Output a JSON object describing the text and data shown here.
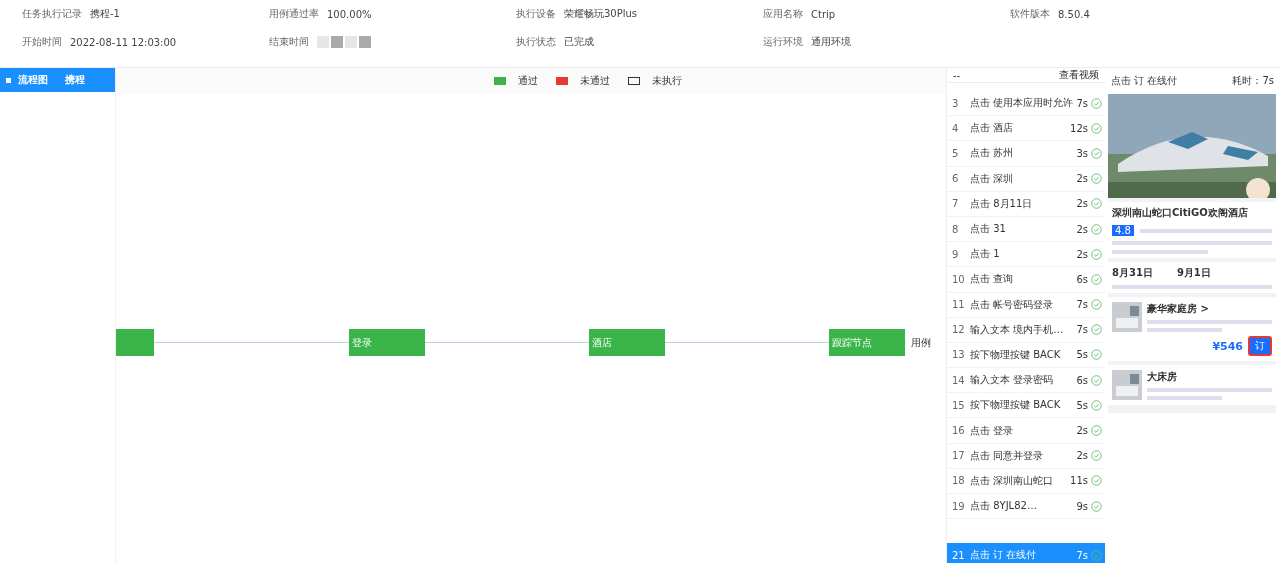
{
  "info_rows": [
    [
      {
        "label": "任务执行记录",
        "value": "携程-1"
      },
      {
        "label": "用例通过率",
        "value": "100.00%"
      },
      {
        "label": "执行设备",
        "value": "荣耀畅玩30Plus"
      },
      {
        "label": "应用名称",
        "value": "Ctrip"
      },
      {
        "label": "软件版本",
        "value": "8.50.4"
      }
    ],
    [
      {
        "label": "开始时间",
        "value": "2022-08-11 12:03:00"
      },
      {
        "label": "结束时间",
        "redacted": true
      },
      {
        "label": "执行状态",
        "value": "已完成"
      },
      {
        "label": "运行环境",
        "value": "通用环境"
      }
    ]
  ],
  "sidebar": {
    "items": [
      {
        "label": "流程图",
        "value": "携程",
        "selected": true
      }
    ]
  },
  "legend": [
    {
      "label": "通过",
      "kind": "filled",
      "color": "#3bb54a"
    },
    {
      "label": "未通过",
      "kind": "filled",
      "color": "#e53935"
    },
    {
      "label": "未执行",
      "kind": "outline",
      "color": "#333333"
    }
  ],
  "flow": {
    "nodes": [
      {
        "passed": true,
        "cut": true
      },
      {
        "label": "登录",
        "passed": true
      },
      {
        "label": "酒店",
        "passed": true
      },
      {
        "label": "跟踪节点",
        "passed": true
      }
    ],
    "trailing_label": "用例"
  },
  "steps_header": {
    "left": "--",
    "right": "查看视频"
  },
  "steps": [
    {
      "index": "3",
      "action": "点击 使用本应用时允许",
      "time": "7s",
      "passed": true,
      "selected": false
    },
    {
      "index": "4",
      "action": "点击 酒店",
      "time": "12s",
      "passed": true,
      "selected": false
    },
    {
      "index": "5",
      "action": "点击 苏州",
      "time": "3s",
      "passed": true,
      "selected": false
    },
    {
      "index": "6",
      "action": "点击 深圳",
      "time": "2s",
      "passed": true,
      "selected": false
    },
    {
      "index": "7",
      "action": "点击 8月11日",
      "time": "2s",
      "passed": true,
      "selected": false
    },
    {
      "index": "8",
      "action": "点击 31",
      "time": "2s",
      "passed": true,
      "selected": false
    },
    {
      "index": "9",
      "action": "点击 1",
      "time": "2s",
      "passed": true,
      "selected": false
    },
    {
      "index": "10",
      "action": "点击 查询",
      "time": "6s",
      "passed": true,
      "selected": false
    },
    {
      "index": "11",
      "action": "点击 帐号密码登录",
      "time": "7s",
      "passed": true,
      "selected": false
    },
    {
      "index": "12",
      "action": "输入文本 境内手机…",
      "time": "7s",
      "passed": true,
      "selected": false
    },
    {
      "index": "13",
      "action": "按下物理按键 BACK",
      "time": "5s",
      "passed": true,
      "selected": false
    },
    {
      "index": "14",
      "action": "输入文本 登录密码",
      "time": "6s",
      "passed": true,
      "selected": false
    },
    {
      "index": "15",
      "action": "按下物理按键 BACK",
      "time": "5s",
      "passed": true,
      "selected": false
    },
    {
      "index": "16",
      "action": "点击 登录",
      "time": "2s",
      "passed": true,
      "selected": false
    },
    {
      "index": "17",
      "action": "点击 同意并登录",
      "time": "2s",
      "passed": true,
      "selected": false
    },
    {
      "index": "18",
      "action": "点击 深圳南山蛇口",
      "time": "11s",
      "passed": true,
      "selected": false
    },
    {
      "index": "19",
      "action": "点击 8YJL82…",
      "time": "9s",
      "passed": true,
      "selected": false
    },
    {
      "index": "21",
      "action": "点击 订 在线付",
      "time": "7s",
      "passed": true,
      "selected": true
    }
  ],
  "detail": {
    "title": "点击 订 在线付",
    "duration": "耗时：7s"
  },
  "phone": {
    "hotel_name": "深圳南山蛇口CitiGO欢阁酒店",
    "rating": "4.8",
    "checkin": "8月31日",
    "checkout": "9月1日",
    "rooms": [
      {
        "name": "豪华家庭房 >",
        "price": "¥546",
        "book": "订"
      },
      {
        "name": "大床房"
      }
    ]
  }
}
